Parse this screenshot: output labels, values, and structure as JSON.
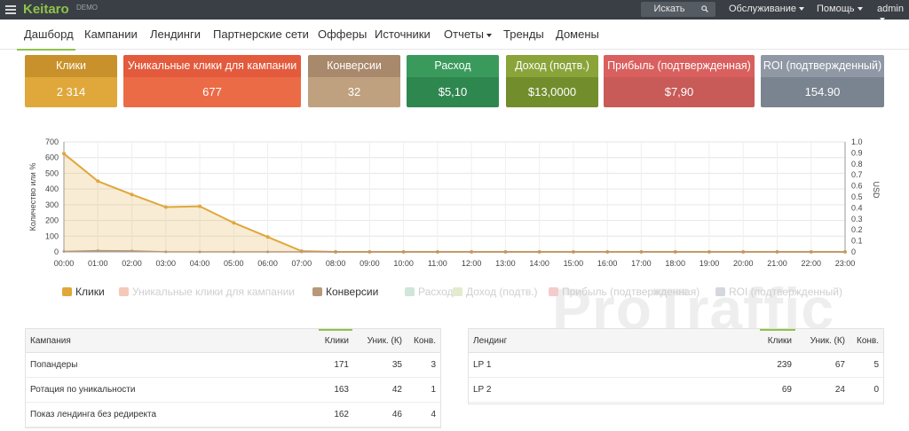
{
  "topbar": {
    "brand": "Keitaro",
    "demo": "DEMO",
    "search_label": "Искать",
    "menus": [
      "Обслуживание",
      "Помощь",
      "admin"
    ]
  },
  "nav": {
    "items": [
      "Дашборд",
      "Кампании",
      "Лендинги",
      "Партнерские сети",
      "Офферы",
      "Источники",
      "Отчеты",
      "Тренды",
      "Домены"
    ]
  },
  "kpis": [
    {
      "label": "Клики",
      "value": "2 314",
      "head": "#c9912b",
      "body": "#e0a73a"
    },
    {
      "label": "Уникальные клики для кампании",
      "value": "677",
      "head": "#e35a3c",
      "body": "#ec6b47"
    },
    {
      "label": "Конверсии",
      "value": "32",
      "head": "#a8896b",
      "body": "#c0a17f"
    },
    {
      "label": "Расход",
      "value": "$5,10",
      "head": "#3a9a5c",
      "body": "#2f8750"
    },
    {
      "label": "Доход (подтв.)",
      "value": "$13,0000",
      "head": "#8aa43a",
      "body": "#728d2c"
    },
    {
      "label": "Прибыль (подтвержденная)",
      "value": "$7,90",
      "head": "#d9605e",
      "body": "#c85a58"
    },
    {
      "label": "ROI (подтвержденный)",
      "value": "154.90",
      "head": "#8f98a4",
      "body": "#7a8490"
    }
  ],
  "chart_data": {
    "type": "area",
    "ylabel": "Количество или %",
    "y2label": "USD",
    "ylim": [
      0,
      700
    ],
    "y2lim": [
      0,
      1
    ],
    "yticks": [
      0,
      100,
      200,
      300,
      400,
      500,
      600,
      700
    ],
    "y2ticks": [
      "0",
      "0.1",
      "0.2",
      "0.3",
      "0.4",
      "0.5",
      "0.6",
      "0.7",
      "0.8",
      "0.9",
      "1.0"
    ],
    "x": [
      "00:00",
      "01:00",
      "02:00",
      "03:00",
      "04:00",
      "05:00",
      "06:00",
      "07:00",
      "08:00",
      "09:00",
      "10:00",
      "11:00",
      "12:00",
      "13:00",
      "14:00",
      "15:00",
      "16:00",
      "17:00",
      "18:00",
      "19:00",
      "20:00",
      "21:00",
      "22:00",
      "23:00"
    ],
    "series": [
      {
        "name": "Клики",
        "color": "#e0a73a",
        "values": [
          625,
          450,
          365,
          285,
          290,
          185,
          95,
          5,
          0,
          0,
          0,
          0,
          0,
          0,
          0,
          0,
          0,
          0,
          0,
          0,
          0,
          0,
          0,
          0
        ]
      },
      {
        "name": "Уникальные клики для кампании",
        "color": "#f5c8b8",
        "values": [
          0,
          0,
          0,
          0,
          0,
          0,
          0,
          0,
          0,
          0,
          0,
          0,
          0,
          0,
          0,
          0,
          0,
          0,
          0,
          0,
          0,
          0,
          0,
          0
        ]
      },
      {
        "name": "Конверсии",
        "color": "#b8977a",
        "values": [
          3,
          8,
          6,
          0,
          0,
          0,
          0,
          0,
          0,
          0,
          0,
          0,
          0,
          0,
          0,
          0,
          0,
          0,
          0,
          0,
          0,
          0,
          0,
          0
        ]
      },
      {
        "name": "Расход",
        "color": "#cfe6d8",
        "values": [
          0,
          0,
          0,
          0,
          0,
          0,
          0,
          0,
          0,
          0,
          0,
          0,
          0,
          0,
          0,
          0,
          0,
          0,
          0,
          0,
          0,
          0,
          0,
          0
        ]
      },
      {
        "name": "Доход (подтв.)",
        "color": "#e3ebcd",
        "values": [
          0,
          0,
          0,
          0,
          0,
          0,
          0,
          0,
          0,
          0,
          0,
          0,
          0,
          0,
          0,
          0,
          0,
          0,
          0,
          0,
          0,
          0,
          0,
          0
        ]
      },
      {
        "name": "Прибыль (подтвержденная)",
        "color": "#f3cccb",
        "values": [
          0,
          0,
          0,
          0,
          0,
          0,
          0,
          0,
          0,
          0,
          0,
          0,
          0,
          0,
          0,
          0,
          0,
          0,
          0,
          0,
          0,
          0,
          0,
          0
        ]
      },
      {
        "name": "ROI (подтвержденный)",
        "color": "#d4d8dd",
        "values": [
          0,
          0,
          0,
          0,
          0,
          0,
          0,
          0,
          0,
          0,
          0,
          0,
          0,
          0,
          0,
          0,
          0,
          0,
          0,
          0,
          0,
          0,
          0,
          0
        ]
      }
    ],
    "grid": true,
    "legend": "bottom"
  },
  "watermark": "ProTraffic",
  "campaigns_table": {
    "headers": [
      "Кампания",
      "Клики",
      "Уник. (К)",
      "Конв."
    ],
    "rows": [
      [
        "Попандеры",
        "171",
        "35",
        "3"
      ],
      [
        "Ротация по уникальности",
        "163",
        "42",
        "1"
      ],
      [
        "Показ лендинга без редиректа",
        "162",
        "46",
        "4"
      ]
    ]
  },
  "landings_table": {
    "headers": [
      "Лендинг",
      "Клики",
      "Уник. (К)",
      "Конв."
    ],
    "rows": [
      [
        "LP 1",
        "239",
        "67",
        "5"
      ],
      [
        "LP 2",
        "69",
        "24",
        "0"
      ]
    ]
  }
}
